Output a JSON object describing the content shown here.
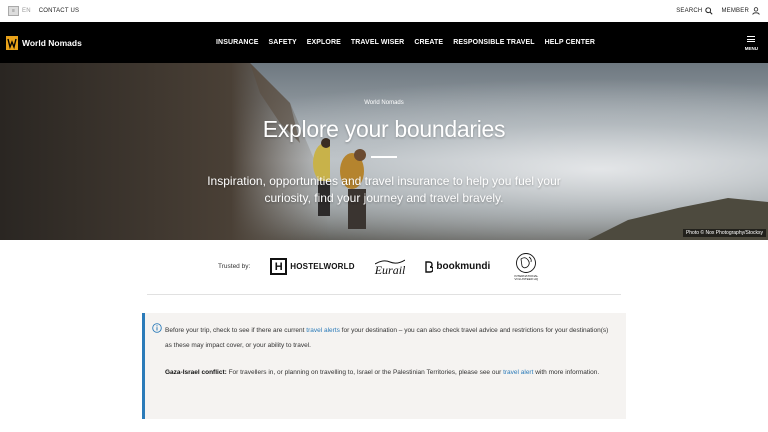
{
  "utility": {
    "lang_box": "≡",
    "lang": "EN",
    "contact": "CONTACT US",
    "search": "SEARCH",
    "member": "MEMBER"
  },
  "header": {
    "brand": "World Nomads",
    "nav": [
      "INSURANCE",
      "SAFETY",
      "EXPLORE",
      "TRAVEL WISER",
      "CREATE",
      "RESPONSIBLE TRAVEL",
      "HELP CENTER"
    ],
    "menu_label": "MENU"
  },
  "hero": {
    "kicker": "World Nomads",
    "title": "Explore your boundaries",
    "subtitle": "Inspiration, opportunities and travel insurance to help you fuel your curiosity, find your journey and travel bravely.",
    "credit": "Photo © Nox Photography/Stocksy"
  },
  "trusted": {
    "label": "Trusted by:",
    "hostelworld_mark": "H",
    "hostelworld": "HOSTELWORLD",
    "eurail": "Eurail",
    "bookmundi": "bookmundi",
    "ivhq": "INTERNATIONAL VOLUNTEER HQ"
  },
  "notice": {
    "p1_before": "Before your trip, check to see if there are current ",
    "p1_link": "travel alerts",
    "p1_after": " for your destination – you can also check travel advice and restrictions for your destination(s) as these may impact cover, or your ability to travel.",
    "p2_bold": "Gaza-Israel conflict:",
    "p2_before": " For travellers in, or planning on travelling to, Israel or the Palestinian Territories, please see our ",
    "p2_link": "travel alert",
    "p2_after": " with more information."
  },
  "colors": {
    "header_bg": "#000000",
    "accent": "#2b7bb9",
    "notice_bg": "#f5f3f1",
    "logo_gold": "#e8a21a"
  },
  "icons": [
    "search-icon",
    "user-icon",
    "hamburger-icon",
    "info-icon",
    "ivhq-globe-icon"
  ]
}
